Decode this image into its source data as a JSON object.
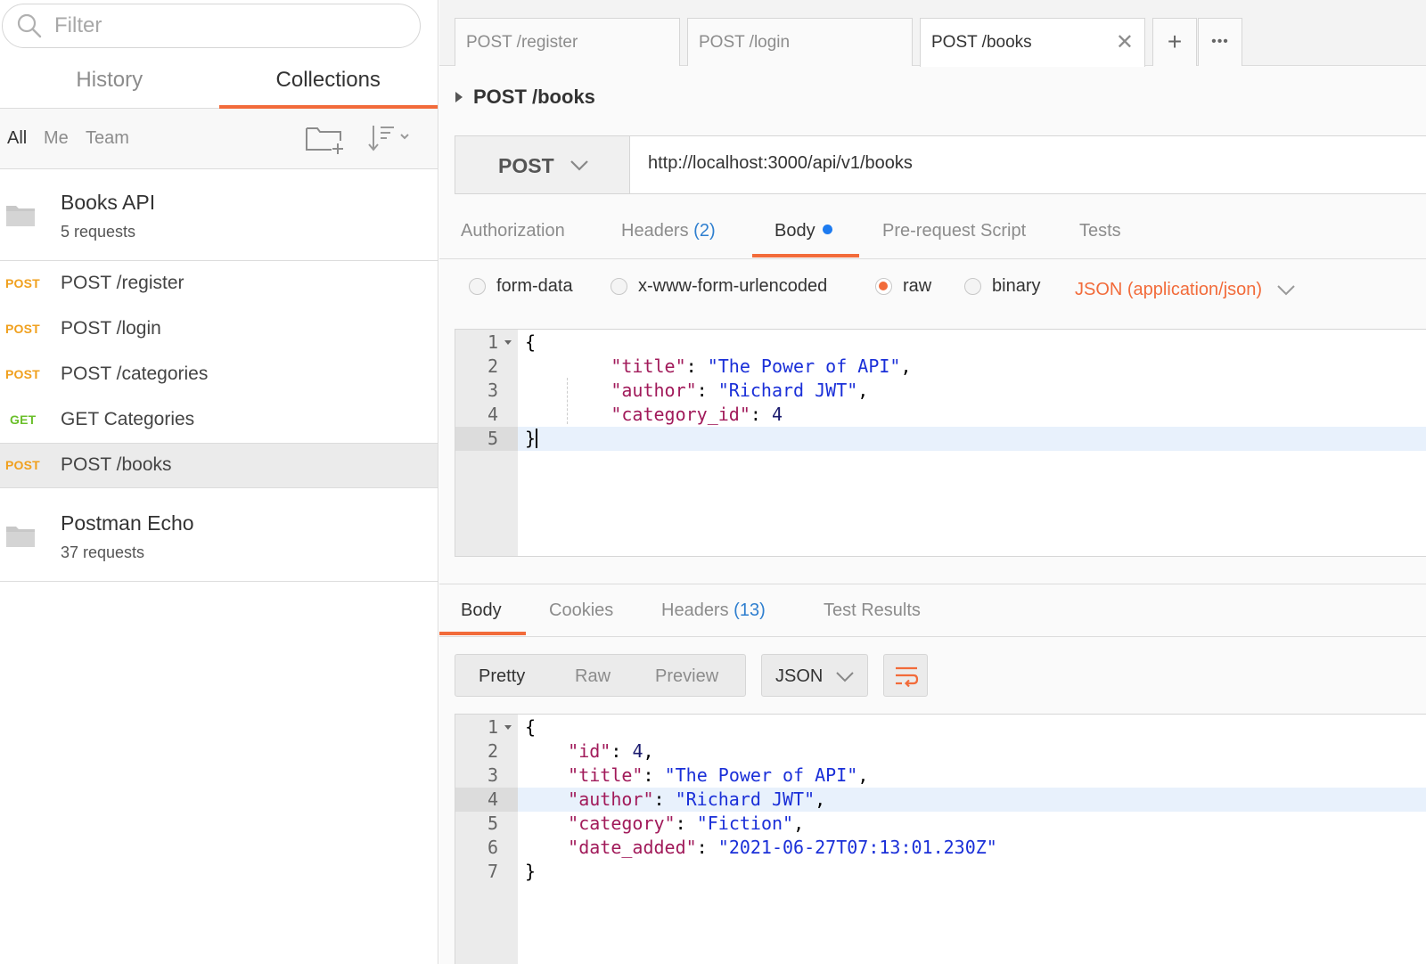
{
  "sidebar": {
    "filter_placeholder": "Filter",
    "tabs": [
      {
        "label": "History",
        "active": false
      },
      {
        "label": "Collections",
        "active": true
      }
    ],
    "scopes": [
      "All",
      "Me",
      "Team"
    ],
    "collections": [
      {
        "name": "Books API",
        "count": "5 requests",
        "requests": [
          {
            "method": "POST",
            "name": "POST /register"
          },
          {
            "method": "POST",
            "name": "POST /login"
          },
          {
            "method": "POST",
            "name": "POST /categories"
          },
          {
            "method": "GET",
            "name": "GET Categories"
          },
          {
            "method": "POST",
            "name": "POST /books",
            "selected": true
          }
        ]
      },
      {
        "name": "Postman Echo",
        "count": "37 requests"
      }
    ],
    "icons": [
      "search-icon",
      "folder-icon",
      "new-folder-icon",
      "sort-icon"
    ]
  },
  "tabs": [
    {
      "label": "POST /register"
    },
    {
      "label": "POST /login"
    },
    {
      "label": "POST /books",
      "active": true,
      "close": "✕"
    }
  ],
  "tab_actions": {
    "add": "+",
    "more": "•••"
  },
  "request": {
    "title": "POST /books",
    "method": "POST",
    "url": "http://localhost:3000/api/v1/books",
    "tabs": [
      {
        "label": "Authorization"
      },
      {
        "label": "Headers",
        "count": "(2)"
      },
      {
        "label": "Body",
        "active": true
      },
      {
        "label": "Pre-request Script"
      },
      {
        "label": "Tests"
      }
    ],
    "body_modes": [
      "form-data",
      "x-www-form-urlencoded",
      "raw",
      "binary"
    ],
    "selected_mode": "raw",
    "content_type": "JSON (application/json)",
    "body_lines": [
      "1",
      "2",
      "3",
      "4",
      "5"
    ],
    "body": {
      "title": "The Power of API",
      "author": "Richard JWT",
      "category_id": "4"
    }
  },
  "response": {
    "tabs": [
      {
        "label": "Body",
        "active": true
      },
      {
        "label": "Cookies"
      },
      {
        "label": "Headers",
        "count": "(13)"
      },
      {
        "label": "Test Results"
      }
    ],
    "view_modes": [
      "Pretty",
      "Raw",
      "Preview"
    ],
    "format": "JSON",
    "body_lines": [
      "1",
      "2",
      "3",
      "4",
      "5",
      "6",
      "7"
    ],
    "body": {
      "id": "4",
      "title": "The Power of API",
      "author": "Richard JWT",
      "category": "Fiction",
      "date_added": "2021-06-27T07:13:01.230Z"
    }
  },
  "colors": {
    "accent": "#f26b3a",
    "post": "#f0a01e",
    "get": "#6abf2a",
    "link_blue": "#2f7fcf",
    "dot": "#1d7bf0"
  }
}
